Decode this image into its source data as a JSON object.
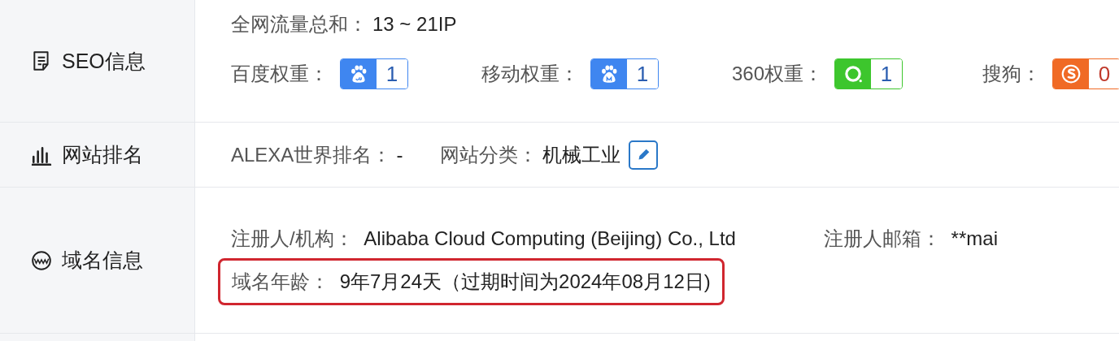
{
  "sections": [
    {
      "kind": "seo",
      "title": "SEO信息",
      "traffic": {
        "label": "全网流量总和：",
        "value": "13 ~ 21IP"
      },
      "weights": [
        {
          "label": "百度权重：",
          "kind": "baidu",
          "value": "1"
        },
        {
          "label": "移动权重：",
          "kind": "mobile",
          "value": "1"
        },
        {
          "label": "360权重：",
          "kind": "qihoo",
          "value": "1"
        },
        {
          "label": "搜狗：",
          "kind": "sogou",
          "value": "0"
        }
      ]
    },
    {
      "kind": "rank",
      "title": "网站排名",
      "alexa": {
        "label": "ALEXA世界排名：",
        "value": "-"
      },
      "category": {
        "label": "网站分类：",
        "value": "机械工业"
      }
    },
    {
      "kind": "domain",
      "title": "域名信息",
      "fields": [
        {
          "label": "注册人/机构：",
          "value": "Alibaba Cloud Computing (Beijing) Co., Ltd"
        },
        {
          "label": "注册人邮箱：",
          "value": "**mai"
        }
      ],
      "age": {
        "label": "域名年龄：",
        "value": "9年7月24天（过期时间为2024年08月12日)",
        "highlighted": true
      }
    }
  ]
}
